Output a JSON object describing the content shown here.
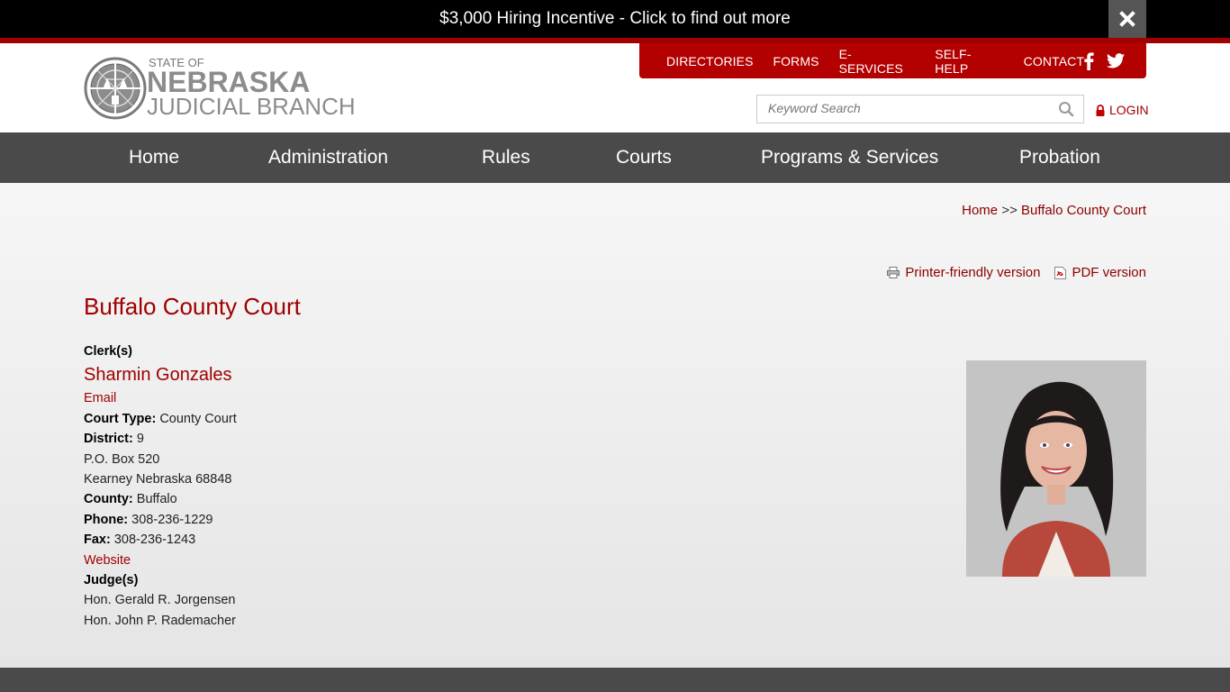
{
  "alert": {
    "text": "$3,000 Hiring Incentive - Click to find out more"
  },
  "logo": {
    "line1": "STATE OF",
    "line2": "NEBRASKA",
    "line3": "JUDICIAL BRANCH"
  },
  "utility_nav": {
    "items": [
      "DIRECTORIES",
      "FORMS",
      "E-SERVICES",
      "SELF-HELP",
      "CONTACT"
    ]
  },
  "search": {
    "placeholder": "Keyword Search"
  },
  "login": {
    "label": "LOGIN"
  },
  "main_nav": {
    "items": [
      "Home",
      "Administration",
      "Rules",
      "Courts",
      "Programs & Services",
      "Probation"
    ]
  },
  "breadcrumb": {
    "home": "Home",
    "separator": ">>",
    "current": "Buffalo County Court"
  },
  "print_links": {
    "printer": "Printer-friendly version",
    "pdf": "PDF version"
  },
  "page": {
    "title": "Buffalo County Court"
  },
  "clerk": {
    "heading": "Clerk(s)",
    "name": "Sharmin Gonzales",
    "email_label": "Email"
  },
  "court": {
    "type_label": "Court Type:",
    "type_value": "County Court",
    "district_label": "District:",
    "district_value": "9",
    "address1": "P.O. Box 520",
    "address2": "Kearney Nebraska 68848",
    "county_label": "County:",
    "county_value": "Buffalo",
    "phone_label": "Phone:",
    "phone_value": "308-236-1229",
    "fax_label": "Fax:",
    "fax_value": "308-236-1243",
    "website_label": "Website"
  },
  "judges": {
    "heading": "Judge(s)",
    "names": [
      "Hon. Gerald R. Jorgensen",
      "Hon. John P. Rademacher"
    ]
  },
  "colors": {
    "brand_red": "#b30000",
    "link_red": "#a00000",
    "nav_gray": "#4a4a4a"
  }
}
